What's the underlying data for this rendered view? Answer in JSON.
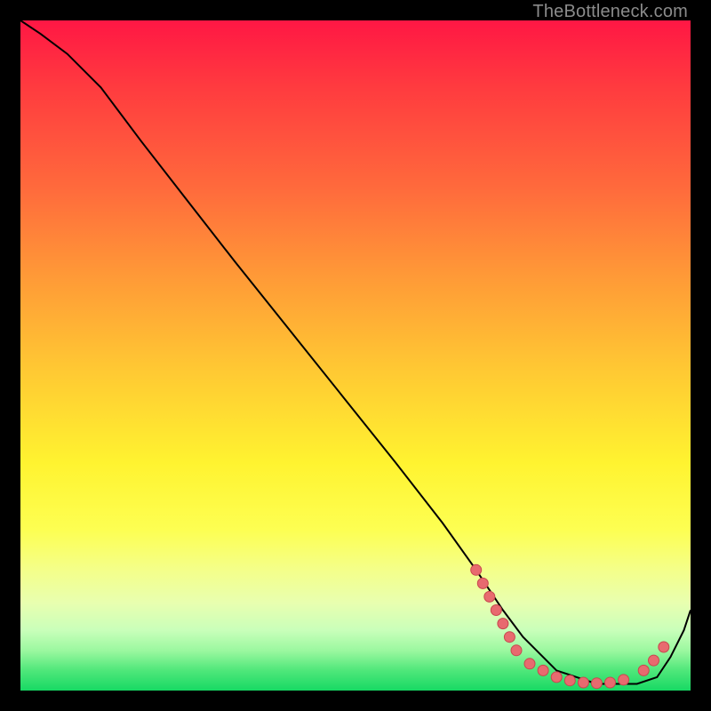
{
  "watermark": "TheBottleneck.com",
  "colors": {
    "curve": "#000000",
    "marker_fill": "#e86a6f",
    "marker_stroke": "#c7484e"
  },
  "chart_data": {
    "type": "line",
    "title": "",
    "xlabel": "",
    "ylabel": "",
    "xlim": [
      0,
      100
    ],
    "ylim": [
      0,
      100
    ],
    "series": [
      {
        "name": "curve",
        "x": [
          0,
          3,
          7,
          12,
          18,
          25,
          32,
          40,
          48,
          56,
          63,
          68,
          72,
          75,
          78,
          80,
          83,
          86,
          89,
          92,
          95,
          97,
          99,
          100
        ],
        "y": [
          100,
          98,
          95,
          90,
          82,
          73,
          64,
          54,
          44,
          34,
          25,
          18,
          12,
          8,
          5,
          3,
          2,
          1,
          1,
          1,
          2,
          5,
          9,
          12
        ]
      }
    ],
    "markers": [
      {
        "x": 68,
        "y": 18
      },
      {
        "x": 69,
        "y": 16
      },
      {
        "x": 70,
        "y": 14
      },
      {
        "x": 71,
        "y": 12
      },
      {
        "x": 72,
        "y": 10
      },
      {
        "x": 73,
        "y": 8
      },
      {
        "x": 74,
        "y": 6
      },
      {
        "x": 76,
        "y": 4
      },
      {
        "x": 78,
        "y": 3
      },
      {
        "x": 80,
        "y": 2
      },
      {
        "x": 82,
        "y": 1.5
      },
      {
        "x": 84,
        "y": 1.2
      },
      {
        "x": 86,
        "y": 1.1
      },
      {
        "x": 88,
        "y": 1.2
      },
      {
        "x": 90,
        "y": 1.6
      },
      {
        "x": 93,
        "y": 3
      },
      {
        "x": 94.5,
        "y": 4.5
      },
      {
        "x": 96,
        "y": 6.5
      }
    ]
  }
}
